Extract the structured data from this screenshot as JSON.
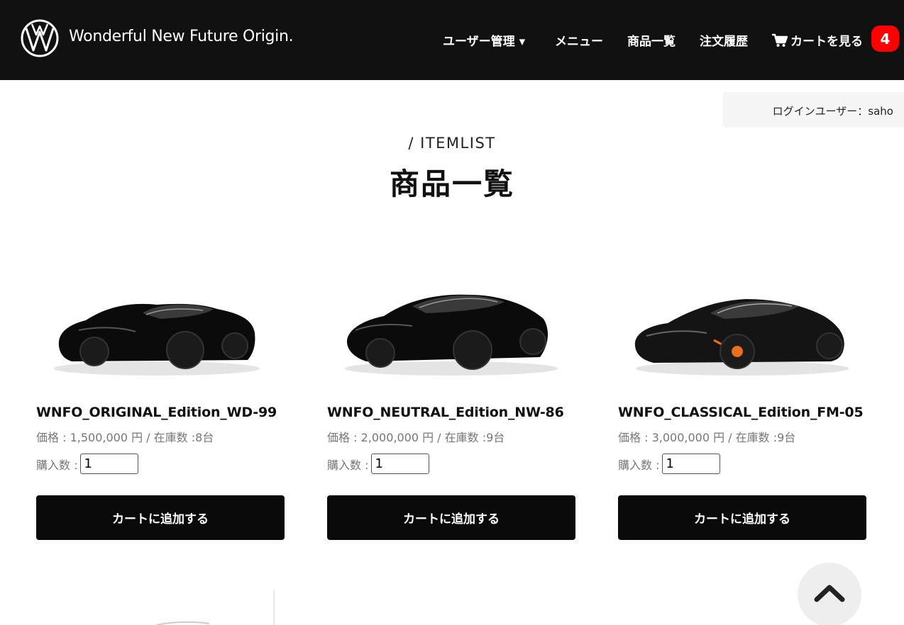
{
  "header": {
    "site_name": "Wonderful New Future Origin.",
    "nav": {
      "user_admin": "ユーザー管理 ▾",
      "menu": "メニュー",
      "items": "商品一覧",
      "orders": "注文履歴",
      "cart": "カートを見る",
      "cart_count": "4"
    }
  },
  "login": {
    "text": "ログインユーザー：saho"
  },
  "page": {
    "subtitle": "/ ITEMLIST",
    "title": "商品一覧"
  },
  "products": [
    {
      "name": "WNFO_ORIGINAL_Edition_WD-99",
      "info": "価格 : 1,500,000 円 / 在庫数 :8台",
      "qty_label": "購入数 :",
      "qty_value": "1",
      "button": "カートに追加する"
    },
    {
      "name": "WNFO_NEUTRAL_Edition_NW-86",
      "info": "価格 : 2,000,000 円 / 在庫数 :9台",
      "qty_label": "購入数 :",
      "qty_value": "1",
      "button": "カートに追加する"
    },
    {
      "name": "WNFO_CLASSICAL_Edition_FM-05",
      "info": "価格 : 3,000,000 円 / 在庫数 :9台",
      "qty_label": "購入数 :",
      "qty_value": "1",
      "button": "カートに追加する"
    }
  ],
  "icons": {
    "logo": "vw-style-logo-icon",
    "cart": "shopping-cart-icon",
    "scroll_top": "chevron-up-icon"
  },
  "colors": {
    "header_bg": "#111111",
    "badge": "#ff0000",
    "button_bg": "#0a0a0a"
  }
}
